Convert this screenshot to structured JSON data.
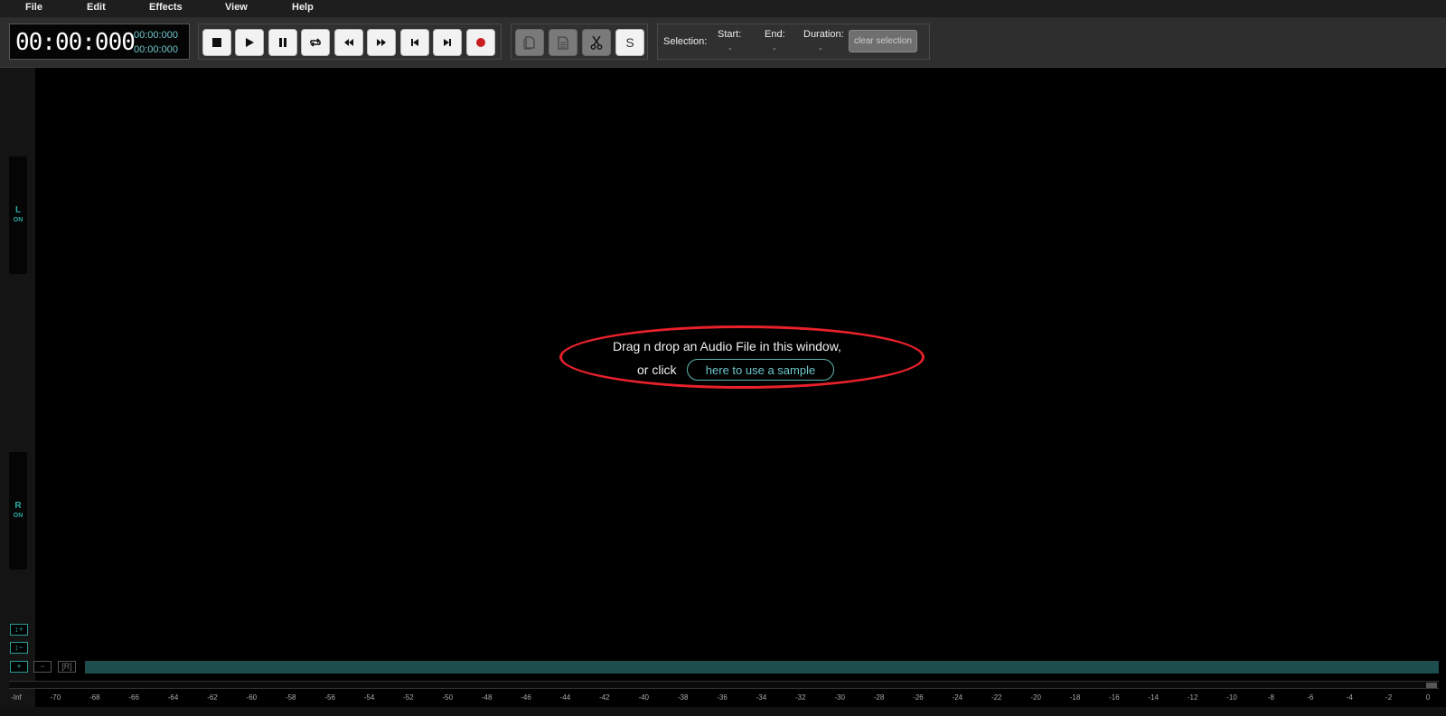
{
  "menu": [
    "File",
    "Edit",
    "Effects",
    "View",
    "Help"
  ],
  "time": {
    "main": "00:00:000",
    "sub_top": "00:00:000",
    "sub_bottom": "00:00:000"
  },
  "transport": [
    {
      "name": "stop-icon"
    },
    {
      "name": "play-icon"
    },
    {
      "name": "pause-icon"
    },
    {
      "name": "loop-icon"
    },
    {
      "name": "rewind-icon"
    },
    {
      "name": "fast-forward-icon"
    },
    {
      "name": "skip-to-start-icon"
    },
    {
      "name": "skip-to-end-icon"
    },
    {
      "name": "record-icon"
    }
  ],
  "edit_tools": {
    "copy_icon": "copy-icon",
    "paste_icon": "paste-icon",
    "cut_icon": "scissors-icon",
    "s_label": "S"
  },
  "selection": {
    "label": "Selection:",
    "start_label": "Start:",
    "start_value": "-",
    "end_label": "End:",
    "end_value": "-",
    "duration_label": "Duration:",
    "duration_value": "-",
    "clear_label": "clear selection"
  },
  "channels": {
    "left": {
      "label": "L",
      "status": "ON"
    },
    "right": {
      "label": "R",
      "status": "ON"
    }
  },
  "drop_zone": {
    "line1": "Drag n drop an Audio File in this window,",
    "line2_prefix": "or click",
    "sample_button": "here to use a sample"
  },
  "zoom_buttons": {
    "vzoom_in": "↕+",
    "vzoom_out": "↕−",
    "zoom_in": "+",
    "zoom_out": "−",
    "reset": "[R]"
  },
  "scale_labels": [
    "-Inf",
    "-70",
    "-68",
    "-66",
    "-64",
    "-62",
    "-60",
    "-58",
    "-56",
    "-54",
    "-52",
    "-50",
    "-48",
    "-46",
    "-44",
    "-42",
    "-40",
    "-38",
    "-36",
    "-34",
    "-32",
    "-30",
    "-28",
    "-26",
    "-24",
    "-22",
    "-20",
    "-18",
    "-16",
    "-14",
    "-12",
    "-10",
    "-8",
    "-6",
    "-4",
    "-2",
    "0"
  ],
  "colors": {
    "accent": "#2fa8a3",
    "highlight": "#e8212b",
    "overview": "#1d4d4c",
    "record": "#c81e1e"
  }
}
